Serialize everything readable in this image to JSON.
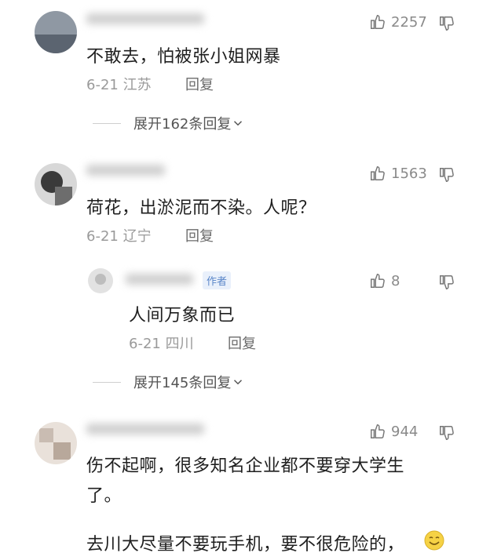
{
  "comments": [
    {
      "text": "不敢去，怕被张小姐网暴",
      "date": "6-21",
      "location": "江苏",
      "reply_label": "回复",
      "likes": "2257",
      "expand_label": "展开162条回复",
      "chevron_icon": "chevron-down-icon"
    },
    {
      "text": "荷花，出淤泥而不染。人呢？",
      "date": "6-21",
      "location": "辽宁",
      "reply_label": "回复",
      "likes": "1563",
      "expand_label": "展开145条回复",
      "reply": {
        "author_tag": "作者",
        "text": "人间万象而已",
        "date": "6-21",
        "location": "四川",
        "reply_label": "回复",
        "likes": "8"
      }
    },
    {
      "text_line1": "伤不起啊，很多知名企业都不要穿大学生",
      "text_line2": "了。",
      "likes": "944"
    }
  ],
  "footer_text": "去川大尽量不要玩手机，要不很危险的，",
  "emoji": "smile-emoji",
  "colors": {
    "author_tag_text": "#5a86c8",
    "author_tag_bg": "#e9f0fb",
    "meta": "#9a9a9a"
  }
}
